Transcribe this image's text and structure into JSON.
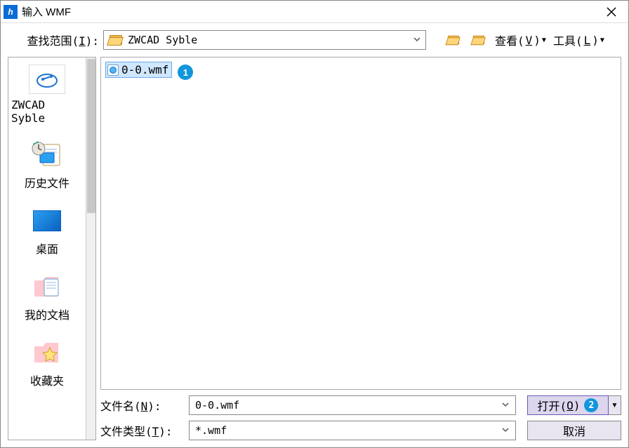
{
  "title": "输入 WMF",
  "lookin": {
    "label_pre": "查找范围(",
    "label_u": "I",
    "label_post": "):",
    "value": "ZWCAD Syble"
  },
  "toolbar": {
    "view_pre": "查看(",
    "view_u": "V",
    "view_post": ")",
    "tools_pre": "工具(",
    "tools_u": "L",
    "tools_post": ")"
  },
  "sidebar": {
    "items": [
      {
        "label": "ZWCAD Syble"
      },
      {
        "label": "历史文件"
      },
      {
        "label": "桌面"
      },
      {
        "label": "我的文档"
      },
      {
        "label": "收藏夹"
      }
    ]
  },
  "filelist": {
    "file_name": "0-0.wmf",
    "badge1": "1"
  },
  "form": {
    "name_label_pre": "文件名(",
    "name_label_u": "N",
    "name_label_post": "):",
    "name_value": "0-0.wmf",
    "type_label_pre": "文件类型(",
    "type_label_u": "T",
    "type_label_post": "):",
    "type_value": "*.wmf"
  },
  "buttons": {
    "open_pre": "打开(",
    "open_u": "O",
    "open_post": ")",
    "open_badge": "2",
    "cancel": "取消"
  }
}
